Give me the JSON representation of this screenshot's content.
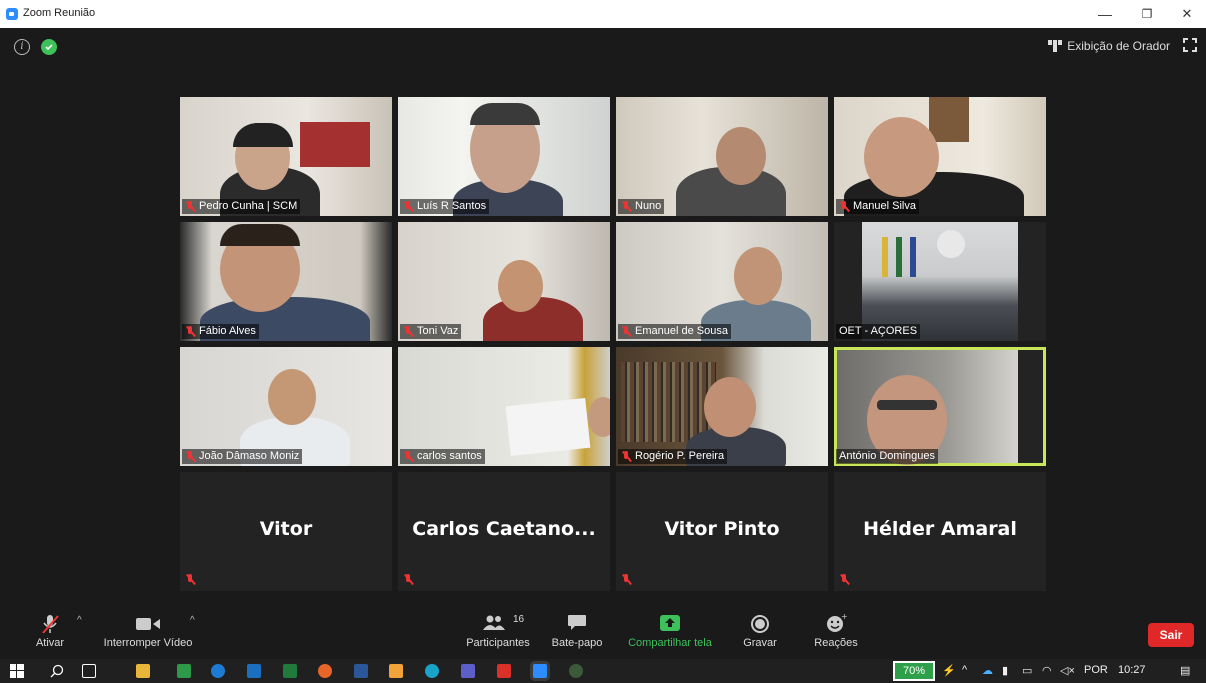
{
  "window": {
    "title": "Zoom Reunião",
    "minimize": "—",
    "restore": "❐",
    "close": "✕"
  },
  "topbar": {
    "speaker_view_label": "Exibição de Orador"
  },
  "participants": [
    {
      "name": "Pedro Cunha | SCM",
      "muted": true
    },
    {
      "name": "Luís R Santos",
      "muted": true
    },
    {
      "name": "Nuno",
      "muted": true
    },
    {
      "name": "Manuel Silva",
      "muted": true
    },
    {
      "name": "Fábio Alves",
      "muted": true
    },
    {
      "name": "Toni Vaz",
      "muted": true
    },
    {
      "name": "Emanuel de Sousa",
      "muted": true
    },
    {
      "name": "OET - AÇORES",
      "muted": false
    },
    {
      "name": "João Dâmaso Moniz",
      "muted": true
    },
    {
      "name": "carlos santos",
      "muted": true
    },
    {
      "name": "Rogério P. Pereira",
      "muted": true
    },
    {
      "name": "António Domingues",
      "muted": false,
      "active_speaker": true
    },
    {
      "name": "Vitor",
      "muted": true,
      "video": false
    },
    {
      "name": "Carlos  Caetano...",
      "muted": true,
      "video": false
    },
    {
      "name": "Vitor Pinto",
      "muted": true,
      "video": false
    },
    {
      "name": "Hélder Amaral",
      "muted": true,
      "video": false
    }
  ],
  "toolbar": {
    "unmute_label": "Ativar",
    "stop_video_label": "Interromper Vídeo",
    "participants_label": "Participantes",
    "participants_count": "16",
    "chat_label": "Bate-papo",
    "share_label": "Compartilhar tela",
    "record_label": "Gravar",
    "reactions_label": "Reações",
    "leave_label": "Sair"
  },
  "taskbar": {
    "battery": "70%",
    "language": "POR",
    "time": "10:27"
  },
  "colors": {
    "active_speaker": "#c8e65a",
    "leave": "#e02828",
    "share": "#3ec15b",
    "muted": "#ee3333"
  }
}
